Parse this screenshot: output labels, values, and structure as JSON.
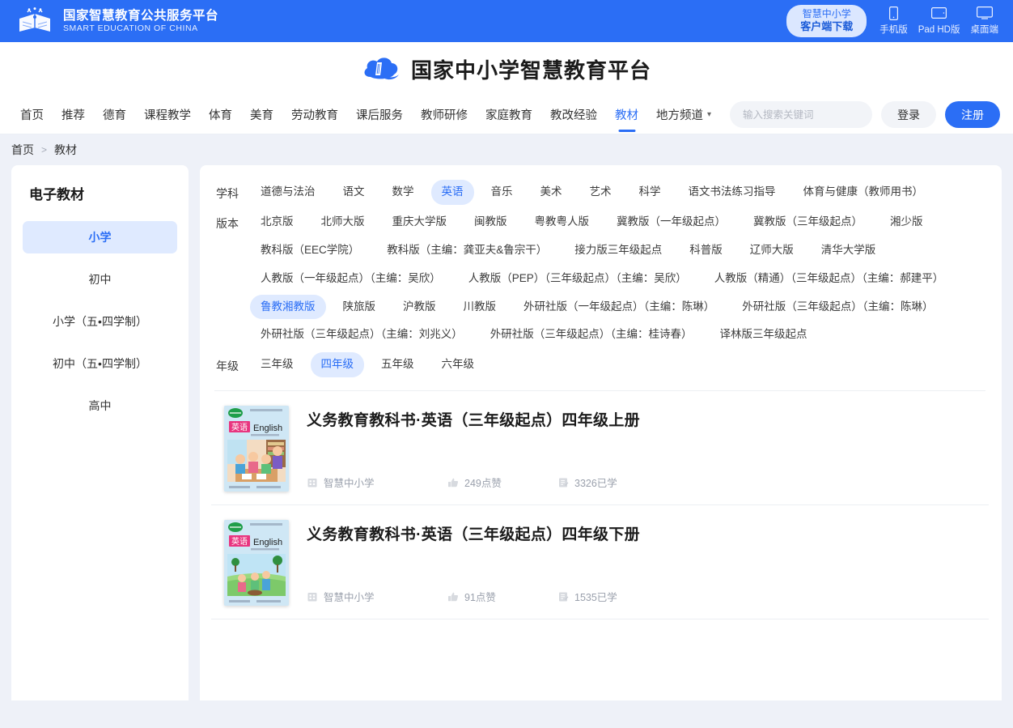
{
  "topbar": {
    "logo_cn": "国家智慧教育公共服务平台",
    "logo_en": "SMART EDUCATION OF CHINA",
    "client_download_line1": "智慧中小学",
    "client_download_line2": "客户端下载",
    "devices": [
      {
        "label": "手机版",
        "icon": "phone-icon"
      },
      {
        "label": "Pad HD版",
        "icon": "tablet-icon"
      },
      {
        "label": "桌面端",
        "icon": "desktop-icon"
      }
    ]
  },
  "brand": {
    "title": "国家中小学智慧教育平台",
    "icon": "cloud-book-icon"
  },
  "nav": {
    "items": [
      {
        "label": "首页",
        "active": false
      },
      {
        "label": "推荐",
        "active": false
      },
      {
        "label": "德育",
        "active": false
      },
      {
        "label": "课程教学",
        "active": false
      },
      {
        "label": "体育",
        "active": false
      },
      {
        "label": "美育",
        "active": false
      },
      {
        "label": "劳动教育",
        "active": false
      },
      {
        "label": "课后服务",
        "active": false
      },
      {
        "label": "教师研修",
        "active": false
      },
      {
        "label": "家庭教育",
        "active": false
      },
      {
        "label": "教改经验",
        "active": false
      },
      {
        "label": "教材",
        "active": true
      },
      {
        "label": "地方频道",
        "active": false,
        "caret": true
      }
    ],
    "search_placeholder": "输入搜索关键词",
    "search_value": "",
    "login_label": "登录",
    "register_label": "注册"
  },
  "breadcrumb": {
    "home": "首页",
    "separator": ">",
    "current": "教材"
  },
  "sidebar": {
    "title": "电子教材",
    "items": [
      {
        "label": "小学",
        "active": true
      },
      {
        "label": "初中",
        "active": false
      },
      {
        "label": "小学（五•四学制）",
        "active": false
      },
      {
        "label": "初中（五•四学制）",
        "active": false
      },
      {
        "label": "高中",
        "active": false
      }
    ]
  },
  "filters": [
    {
      "label": "学科",
      "options": [
        {
          "label": "道德与法治",
          "active": false
        },
        {
          "label": "语文",
          "active": false
        },
        {
          "label": "数学",
          "active": false
        },
        {
          "label": "英语",
          "active": true
        },
        {
          "label": "音乐",
          "active": false
        },
        {
          "label": "美术",
          "active": false
        },
        {
          "label": "艺术",
          "active": false
        },
        {
          "label": "科学",
          "active": false
        },
        {
          "label": "语文书法练习指导",
          "active": false
        },
        {
          "label": "体育与健康（教师用书）",
          "active": false
        }
      ]
    },
    {
      "label": "版本",
      "options": [
        {
          "label": "北京版",
          "active": false
        },
        {
          "label": "北师大版",
          "active": false
        },
        {
          "label": "重庆大学版",
          "active": false
        },
        {
          "label": "闽教版",
          "active": false
        },
        {
          "label": "粤教粤人版",
          "active": false
        },
        {
          "label": "冀教版（一年级起点）",
          "active": false
        },
        {
          "label": "冀教版（三年级起点）",
          "active": false
        },
        {
          "label": "湘少版",
          "active": false
        },
        {
          "label": "教科版（EEC学院）",
          "active": false
        },
        {
          "label": "教科版（主编：龚亚夫&鲁宗干）",
          "active": false
        },
        {
          "label": "接力版三年级起点",
          "active": false
        },
        {
          "label": "科普版",
          "active": false
        },
        {
          "label": "辽师大版",
          "active": false
        },
        {
          "label": "清华大学版",
          "active": false
        },
        {
          "label": "人教版（一年级起点）（主编：吴欣）",
          "active": false
        },
        {
          "label": "人教版（PEP）（三年级起点）（主编：吴欣）",
          "active": false
        },
        {
          "label": "人教版（精通）（三年级起点）（主编：郝建平）",
          "active": false
        },
        {
          "label": "鲁教湘教版",
          "active": true
        },
        {
          "label": "陕旅版",
          "active": false
        },
        {
          "label": "沪教版",
          "active": false
        },
        {
          "label": "川教版",
          "active": false
        },
        {
          "label": "外研社版（一年级起点）（主编：陈琳）",
          "active": false
        },
        {
          "label": "外研社版（三年级起点）（主编：陈琳）",
          "active": false
        },
        {
          "label": "外研社版（三年级起点）（主编：刘兆义）",
          "active": false
        },
        {
          "label": "外研社版（三年级起点）（主编：桂诗春）",
          "active": false
        },
        {
          "label": "译林版三年级起点",
          "active": false
        }
      ]
    },
    {
      "label": "年级",
      "options": [
        {
          "label": "三年级",
          "active": false
        },
        {
          "label": "四年级",
          "active": true
        },
        {
          "label": "五年级",
          "active": false
        },
        {
          "label": "六年级",
          "active": false
        }
      ]
    }
  ],
  "books": [
    {
      "title": "义务教育教科书·英语（三年级起点）四年级上册",
      "publisher": "智慧中小学",
      "likes": "249点赞",
      "learned": "3326已学",
      "cover_subject_cn": "英语",
      "cover_subject_en": "English",
      "cover_scene": "classroom"
    },
    {
      "title": "义务教育教科书·英语（三年级起点）四年级下册",
      "publisher": "智慧中小学",
      "likes": "91点赞",
      "learned": "1535已学",
      "cover_subject_cn": "英语",
      "cover_subject_en": "English",
      "cover_scene": "outdoor"
    }
  ],
  "colors": {
    "brand_blue": "#2b6ef5",
    "pill_active_bg": "#dfeaff",
    "page_bg": "#eef1f8",
    "panel_bg": "#ffffff"
  }
}
